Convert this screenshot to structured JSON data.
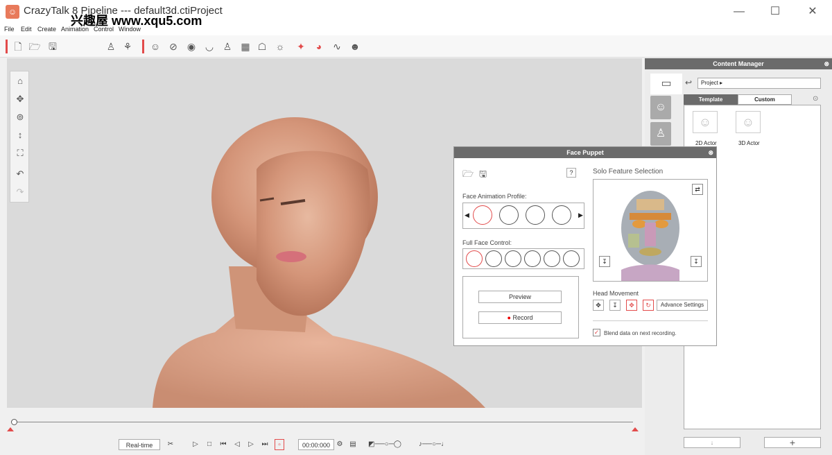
{
  "window": {
    "title": "CrazyTalk 8 Pipeline --- default3d.ctiProject",
    "minimize": "—",
    "maximize": "☐",
    "close": "✕"
  },
  "menu": [
    "File",
    "Edit",
    "Create",
    "Animation",
    "Control",
    "Window"
  ],
  "watermark": "兴趣屋 www.xqu5.com",
  "content_manager": {
    "title": "Content Manager",
    "close": "⊗",
    "path": "Project ▸",
    "tabs": [
      "Template",
      "Custom"
    ],
    "items": [
      "2D Actor",
      "3D Actor"
    ]
  },
  "face_puppet": {
    "title": "Face Puppet",
    "close": "⊗",
    "help": "?",
    "profile_label": "Face Animation Profile:",
    "full_face_label": "Full Face Control:",
    "preview_label": "Preview",
    "record_label": "Record",
    "solo_label": "Solo Feature Selection",
    "head_movement_label": "Head Movement",
    "advance_settings": "Advance Settings",
    "blend_label": "Blend data on next recording.",
    "blend_checked": true
  },
  "timeline": {
    "realtime": "Real-time",
    "timecode": "00:00:000"
  },
  "colors": {
    "accent": "#e24b4b",
    "panel_header": "#6b6b6b"
  }
}
